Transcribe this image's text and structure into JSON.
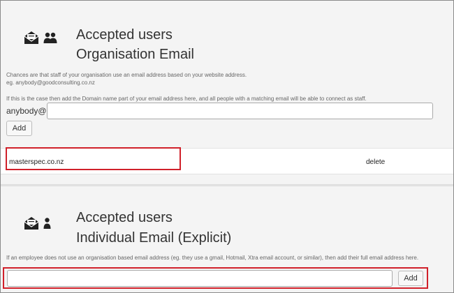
{
  "org_section": {
    "title_line1": "Accepted users",
    "title_line2": "Organisation Email",
    "icons": [
      "envelope-icon",
      "users-icon"
    ],
    "help_line1": "Chances are that staff of your organisation use an email address based on your website address.",
    "help_line2": "eg. anybody@goodconsulting.co.nz",
    "help_line3": "If this is the case then add the Domain name part of your email address here, and all people with a matching email will be able to connect as staff.",
    "input_prefix": "anybody@",
    "input_value": "",
    "add_label": "Add",
    "domains": [
      {
        "domain": "masterspec.co.nz",
        "action": "delete"
      }
    ]
  },
  "individual_section": {
    "title_line1": "Accepted users",
    "title_line2": "Individual Email (Explicit)",
    "icons": [
      "envelope-icon",
      "user-icon"
    ],
    "help_text": "If an employee does not use an organisation based email address (eg. they use a gmail, Hotmail, Xtra email account, or similar), then add their full email address here.",
    "input_value": "",
    "add_label": "Add"
  },
  "colors": {
    "highlight": "#d0202a",
    "background": "#f4f4f4"
  }
}
